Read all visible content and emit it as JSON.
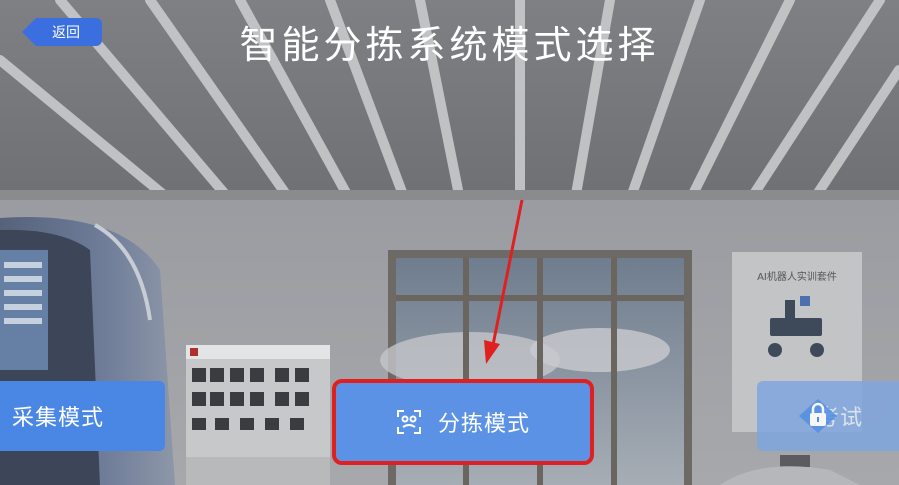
{
  "header": {
    "back_label": "返回",
    "title": "智能分拣系统模式选择"
  },
  "poster": {
    "title": "AI机器人实训套件"
  },
  "modes": [
    {
      "label": "采集模式",
      "icon": "none",
      "selected": false,
      "locked": false
    },
    {
      "label": "分拣模式",
      "icon": "scan-icon",
      "selected": true,
      "locked": false
    },
    {
      "label": "考试",
      "icon": "lock-icon",
      "selected": false,
      "locked": true
    }
  ],
  "colors": {
    "accent": "#3b6fe0",
    "button": "#4a86e4",
    "highlight": "#e02020"
  }
}
